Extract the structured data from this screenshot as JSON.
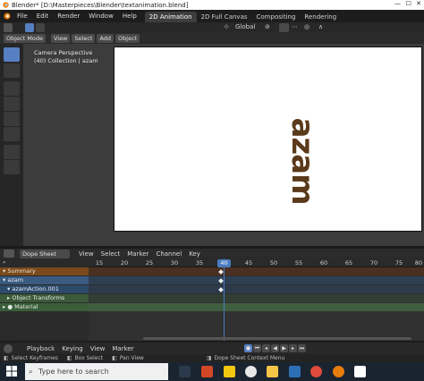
{
  "window": {
    "title": "Blender* [D:\\Masterpieces\\Blender\\textanimation.blend]"
  },
  "menu": {
    "items": [
      "File",
      "Edit",
      "Render",
      "Window",
      "Help"
    ],
    "workspaces": [
      "2D Animation",
      "2D Full Canvas",
      "Compositing",
      "Rendering"
    ],
    "active_workspace": "2D Animation"
  },
  "header": {
    "orientation": "Global"
  },
  "viewport_header": {
    "mode": "Object Mode",
    "menus": [
      "View",
      "Select",
      "Add",
      "Object"
    ]
  },
  "viewport": {
    "info_line1": "Camera Perspective",
    "info_line2": "(40) Collection | azam",
    "text_object": "azam"
  },
  "dopesheet": {
    "editor": "Dope Sheet",
    "menus": [
      "View",
      "Select",
      "Marker",
      "Channel",
      "Key"
    ],
    "ticks": [
      "15",
      "20",
      "25",
      "30",
      "35",
      "40",
      "45",
      "50",
      "55",
      "60",
      "65",
      "70",
      "75",
      "80"
    ],
    "current_frame": "40",
    "channels": [
      {
        "label": "Summary"
      },
      {
        "label": "azam"
      },
      {
        "label": "azamAction.001"
      },
      {
        "label": "Object Transforms"
      },
      {
        "label": "Material"
      }
    ]
  },
  "timeline": {
    "menus": [
      "Playback",
      "Keying",
      "View",
      "Marker"
    ]
  },
  "statusbar": {
    "select": "Select Keyframes",
    "box": "Box Select",
    "pan": "Pan View",
    "context": "Dope Sheet Context Menu"
  },
  "taskbar": {
    "search_placeholder": "Type here to search"
  },
  "colors": {
    "accent": "#5680c2",
    "summary_row": "#7a4a1c",
    "object_row": "#3a5a80",
    "action_row": "#2e4a6a",
    "transforms_row": "#3c5a3a",
    "material_row": "#3a5e3a",
    "text_color": "#5a3a1a"
  }
}
